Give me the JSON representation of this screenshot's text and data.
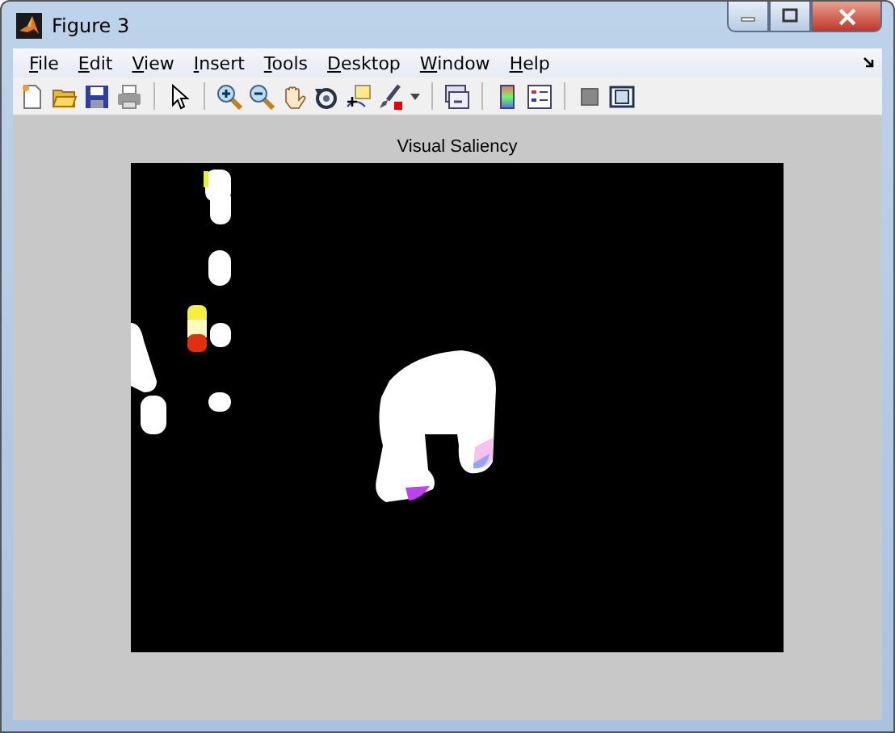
{
  "window": {
    "title": "Figure 3"
  },
  "menus": [
    {
      "label": "File"
    },
    {
      "label": "Edit"
    },
    {
      "label": "View"
    },
    {
      "label": "Insert"
    },
    {
      "label": "Tools"
    },
    {
      "label": "Desktop"
    },
    {
      "label": "Window"
    },
    {
      "label": "Help"
    }
  ],
  "axes": {
    "title": "Visual Saliency"
  }
}
